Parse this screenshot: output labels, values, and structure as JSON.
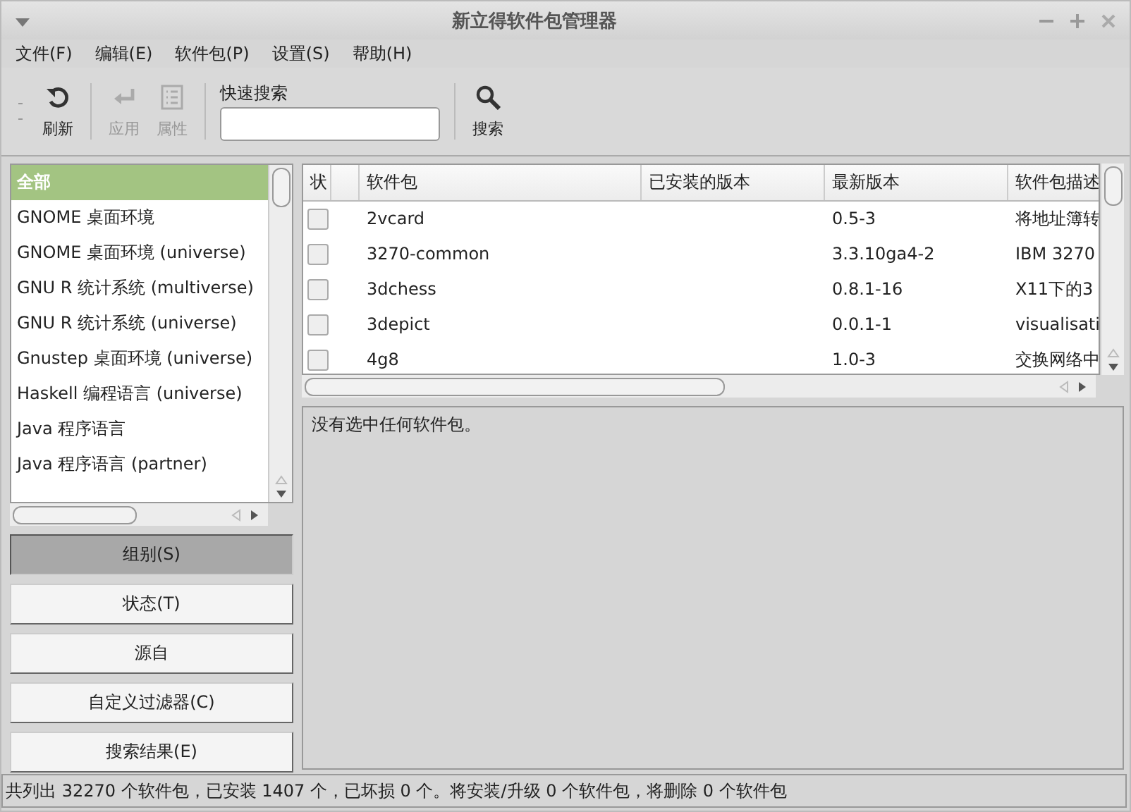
{
  "window": {
    "title": "新立得软件包管理器"
  },
  "menu": [
    "文件(F)",
    "编辑(E)",
    "软件包(P)",
    "设置(S)",
    "帮助(H)"
  ],
  "toolbar": {
    "buttons": [
      {
        "kind": "refresh",
        "label": "刷新",
        "disabled": false
      },
      {
        "kind": "apply",
        "label": "应用",
        "disabled": true
      },
      {
        "kind": "properties",
        "label": "属性",
        "disabled": true
      }
    ],
    "search": {
      "label": "快速搜索"
    },
    "search_button": {
      "label": "搜索"
    }
  },
  "categories": [
    {
      "label": "全部",
      "selected": true
    },
    {
      "label": "GNOME 桌面环境",
      "selected": false
    },
    {
      "label": "GNOME 桌面环境 (universe)",
      "selected": false
    },
    {
      "label": "GNU R 统计系统 (multiverse)",
      "selected": false
    },
    {
      "label": "GNU R 统计系统 (universe)",
      "selected": false
    },
    {
      "label": "Gnustep 桌面环境 (universe)",
      "selected": false
    },
    {
      "label": "Haskell 编程语言 (universe)",
      "selected": false
    },
    {
      "label": "Java 程序语言",
      "selected": false
    },
    {
      "label": "Java 程序语言 (partner)",
      "selected": false
    }
  ],
  "filters": [
    {
      "label": "组别(S)",
      "selected": true
    },
    {
      "label": "状态(T)",
      "selected": false
    },
    {
      "label": "源自",
      "selected": false
    },
    {
      "label": "自定义过滤器(C)",
      "selected": false
    },
    {
      "label": "搜索结果(E)",
      "selected": false
    }
  ],
  "table": {
    "columns": [
      "状",
      "",
      "软件包",
      "已安装的版本",
      "最新版本",
      "软件包描述"
    ],
    "rows": [
      {
        "checked": false,
        "package": "2vcard",
        "latest": "0.5-3",
        "description": "将地址簿转"
      },
      {
        "checked": false,
        "package": "3270-common",
        "latest": "3.3.10ga4-2",
        "description": "IBM 3270"
      },
      {
        "checked": false,
        "package": "3dchess",
        "latest": "0.8.1-16",
        "description": "X11下的3"
      },
      {
        "checked": false,
        "package": "3depict",
        "latest": "0.0.1-1",
        "description": "visualisati"
      },
      {
        "checked": false,
        "package": "4g8",
        "latest": "1.0-3",
        "description": "交换网络中"
      }
    ]
  },
  "details": {
    "text": "没有选中任何软件包。"
  },
  "status_bar": "共列出 32270 个软件包，已安装 1407 个，已坏损 0 个。将安装/升级 0 个软件包，将删除 0 个软件包"
}
